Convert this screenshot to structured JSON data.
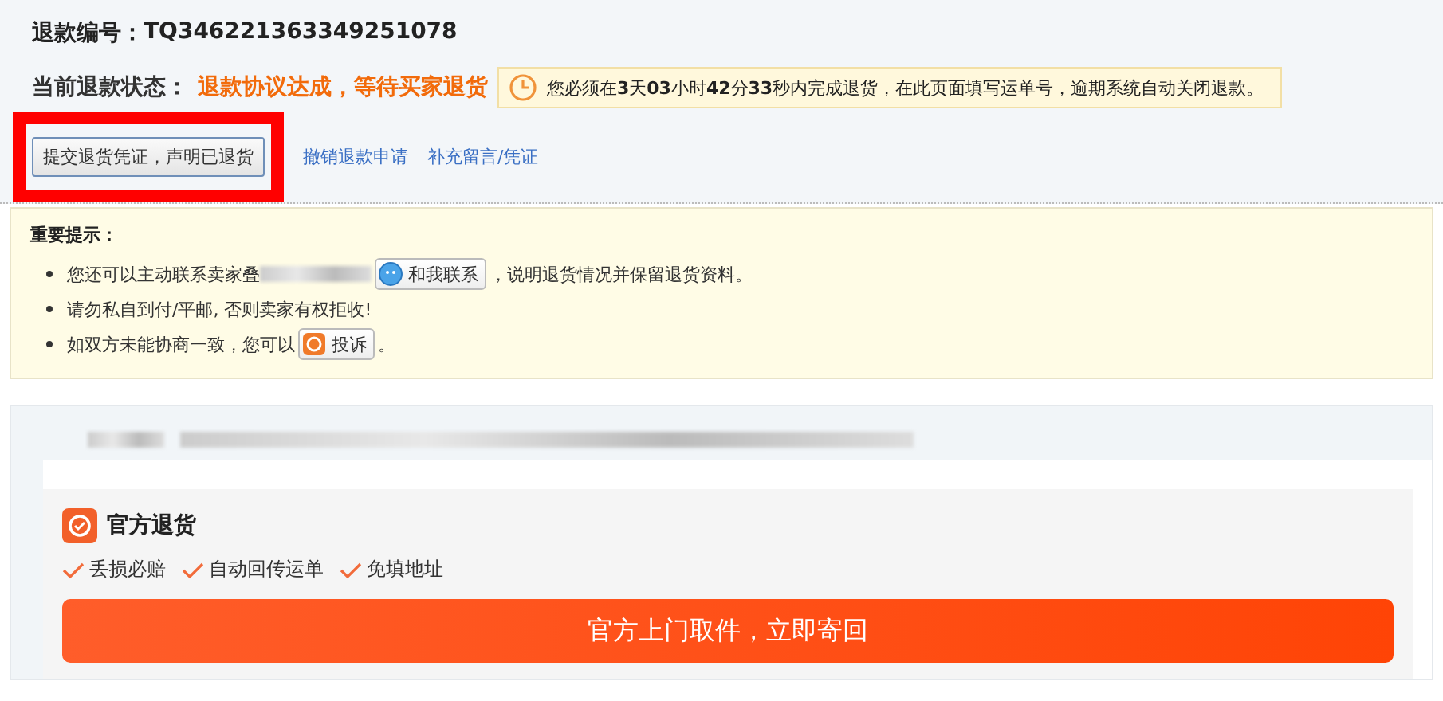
{
  "refund": {
    "number_label": "退款编号：",
    "number": "TQ346221363349251078",
    "status_label": "当前退款状态：",
    "status": "退款协议达成，等待买家退货",
    "deadline": "您必须在**3**天**03**小时**42**分**33**秒内完成退货，在此页面填写运单号，逾期系统自动关闭退款。",
    "actions": [
      {
        "kind": "framed_button",
        "label": "提交退货凭证，声明已退货"
      },
      {
        "kind": "link",
        "label": "撤销退款申请"
      },
      {
        "kind": "link",
        "label": "补充留言/凭证"
      }
    ]
  },
  "notice": {
    "title": "重要提示：",
    "items": [
      {
        "kind": "contact",
        "before": "您还可以主动联系卖家叠",
        "button": "和我联系",
        "after": "，说明退货情况并保留退货资料。"
      },
      {
        "kind": "plain",
        "before": "请勿私自到付/平邮, 否则卖家有权拒收!"
      },
      {
        "kind": "complain",
        "before": "如双方未能协商一致，您可以",
        "button": "投诉",
        "after": "。"
      }
    ]
  },
  "official": {
    "title": "官方退货",
    "features": [
      "丢损必赔",
      "自动回传运单",
      "免填地址"
    ],
    "button": "官方上门取件，立即寄回"
  }
}
